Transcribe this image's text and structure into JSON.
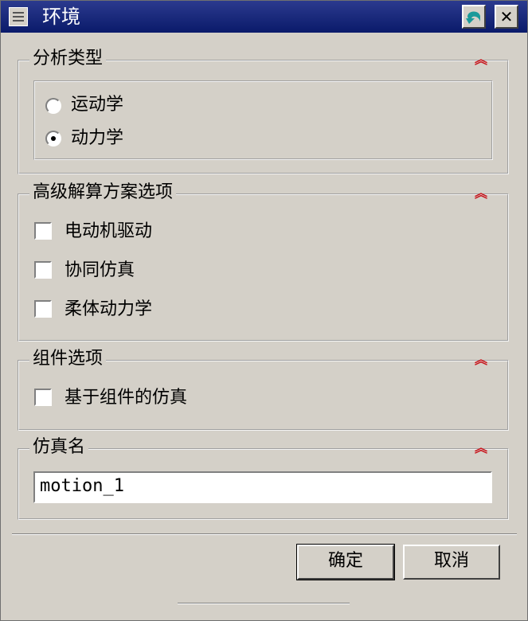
{
  "window": {
    "title": "环境"
  },
  "sections": {
    "analysis_type": {
      "title": "分析类型",
      "options": [
        {
          "label": "运动学",
          "selected": false
        },
        {
          "label": "动力学",
          "selected": true
        }
      ]
    },
    "advanced_solver": {
      "title": "高级解算方案选项",
      "options": [
        {
          "label": "电动机驱动",
          "checked": false
        },
        {
          "label": "协同仿真",
          "checked": false
        },
        {
          "label": "柔体动力学",
          "checked": false
        }
      ]
    },
    "component_options": {
      "title": "组件选项",
      "options": [
        {
          "label": "基于组件的仿真",
          "checked": false
        }
      ]
    },
    "simulation_name": {
      "title": "仿真名",
      "value": "motion_1"
    }
  },
  "buttons": {
    "ok": "确定",
    "cancel": "取消"
  },
  "icons": {
    "collapse": "double-chevron-up-icon",
    "close": "close-icon",
    "back": "back-arrow-icon",
    "menu": "window-menu-icon"
  },
  "colors": {
    "titlebar": "#0a1a6a",
    "collapse": "#c8141c",
    "dialog": "#d4d0c8"
  }
}
